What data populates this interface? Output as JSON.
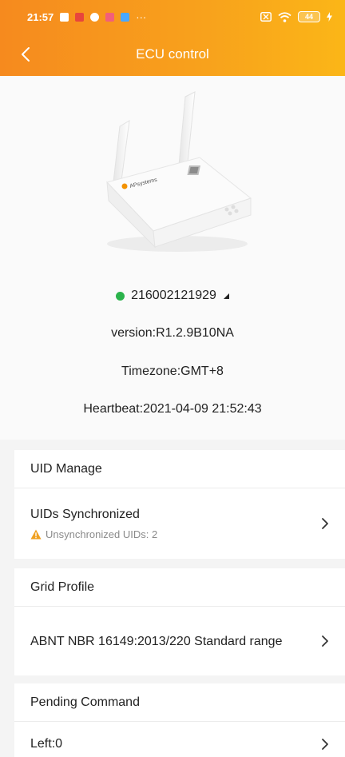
{
  "status_bar": {
    "time": "21:57",
    "more": "···",
    "battery": "44",
    "colors": {
      "notif1": "#ffffff",
      "notif2": "#e8453c",
      "notif3": "#ffffff",
      "notif4": "#f25f7a",
      "notif5": "#4aa8ff"
    }
  },
  "header": {
    "title": "ECU control",
    "back_icon": "chevron-left-icon",
    "gradient": [
      "#f68a1e",
      "#fbb617"
    ]
  },
  "device": {
    "image": "ecu-device-image",
    "brand": "APsystems",
    "ecu_id": "216002121929",
    "online_color": "#2bb34b",
    "version": "version:R1.2.9B10NA",
    "timezone": "Timezone:GMT+8",
    "heartbeat": "Heartbeat:2021-04-09 21:52:43"
  },
  "uid_manage": {
    "title": "UID Manage",
    "row_label": "UIDs Synchronized",
    "warning": "Unsynchronized UIDs: 2",
    "warning_color": "#f0a020"
  },
  "grid_profile": {
    "title": "Grid Profile",
    "row_label": "ABNT NBR 16149:2013/220 Standard range"
  },
  "pending_command": {
    "title": "Pending Command",
    "row_label": "Left:0"
  }
}
